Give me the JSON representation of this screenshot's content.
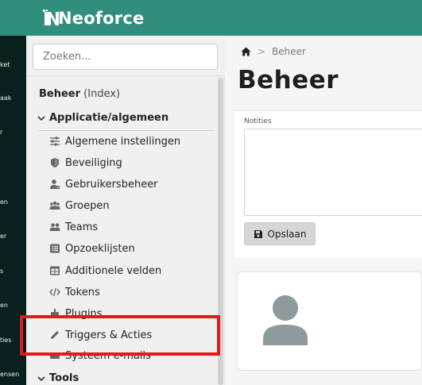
{
  "app": {
    "name": "Neoforce",
    "brand_color": "#2f8f7c"
  },
  "rail": {
    "items": [
      "ket",
      "aak",
      "r",
      "en",
      "er",
      "s",
      "en",
      "ties",
      "ensen"
    ]
  },
  "search": {
    "placeholder": "Zoeken..."
  },
  "nav": {
    "title": "Beheer",
    "title_suffix": "(Index)",
    "group": "Applicatie/algemeen",
    "items": [
      {
        "label": "Algemene instellingen",
        "icon": "sliders-icon"
      },
      {
        "label": "Beveiliging",
        "icon": "shield-icon"
      },
      {
        "label": "Gebruikersbeheer",
        "icon": "user-gear-icon"
      },
      {
        "label": "Groepen",
        "icon": "users-icon"
      },
      {
        "label": "Teams",
        "icon": "team-icon"
      },
      {
        "label": "Opzoeklijsten",
        "icon": "list-icon"
      },
      {
        "label": "Additionele velden",
        "icon": "table-icon"
      },
      {
        "label": "Tokens",
        "icon": "code-icon"
      },
      {
        "label": "Plugins",
        "icon": "plugin-icon"
      },
      {
        "label": "Triggers & Acties",
        "icon": "pencil-icon"
      },
      {
        "label": "Systeem e-mails",
        "icon": "mail-icon"
      }
    ],
    "group2": "Tools",
    "highlight_color": "#e11b1b"
  },
  "breadcrumb": {
    "current": "Beheer"
  },
  "page": {
    "title": "Beheer",
    "notes_label": "Notities",
    "notes_value": "",
    "save_label": "Opslaan"
  }
}
